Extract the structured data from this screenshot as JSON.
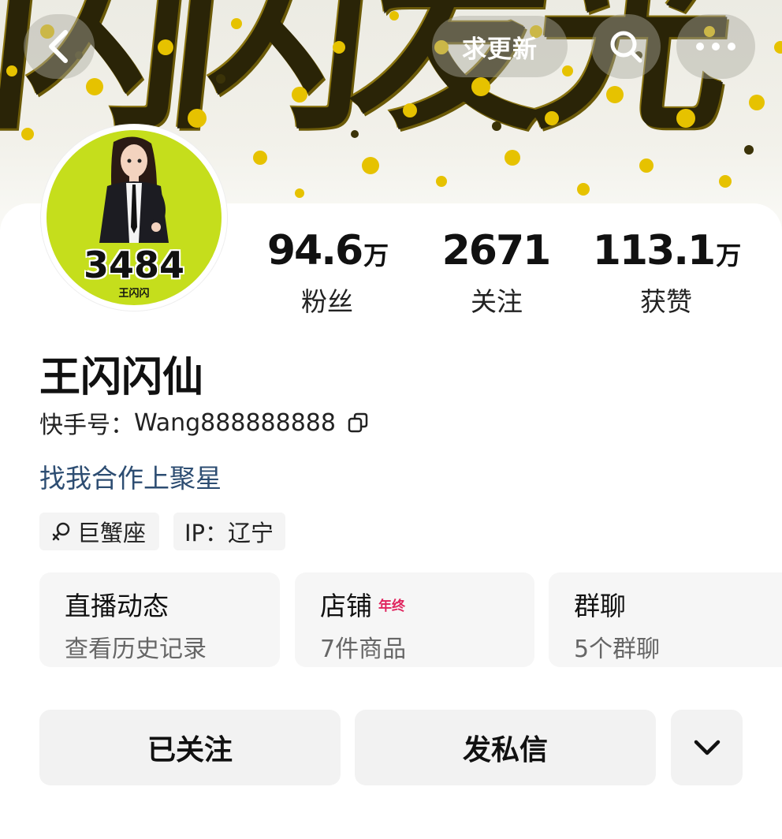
{
  "banner": {
    "text": "闪闪发光",
    "accent_color": "#e6c200",
    "back_icon": "chevron-left-icon",
    "update_label": "求更新",
    "search_icon": "search-icon",
    "more_icon": "more-dots-icon"
  },
  "profile": {
    "avatar_number": "3484",
    "avatar_caption": "王闪闪",
    "avatar_bg": "#c5de1c",
    "name": "王闪闪仙",
    "account_label": "快手号：",
    "account_id": "Wang888888888",
    "bio": "找我合作上聚星"
  },
  "stats": [
    {
      "value": "94.6",
      "unit": "万",
      "label": "粉丝"
    },
    {
      "value": "2671",
      "unit": "",
      "label": "关注"
    },
    {
      "value": "113.1",
      "unit": "万",
      "label": "获赞"
    }
  ],
  "tags": {
    "zodiac": "巨蟹座",
    "ip": "IP：辽宁"
  },
  "entries": [
    {
      "title": "直播动态",
      "badge": "",
      "sub": "查看历史记录"
    },
    {
      "title": "店铺",
      "badge": "年终",
      "sub": "7件商品"
    },
    {
      "title": "群聊",
      "badge": "",
      "sub": "5个群聊"
    }
  ],
  "actions": {
    "follow": "已关注",
    "message": "发私信"
  }
}
